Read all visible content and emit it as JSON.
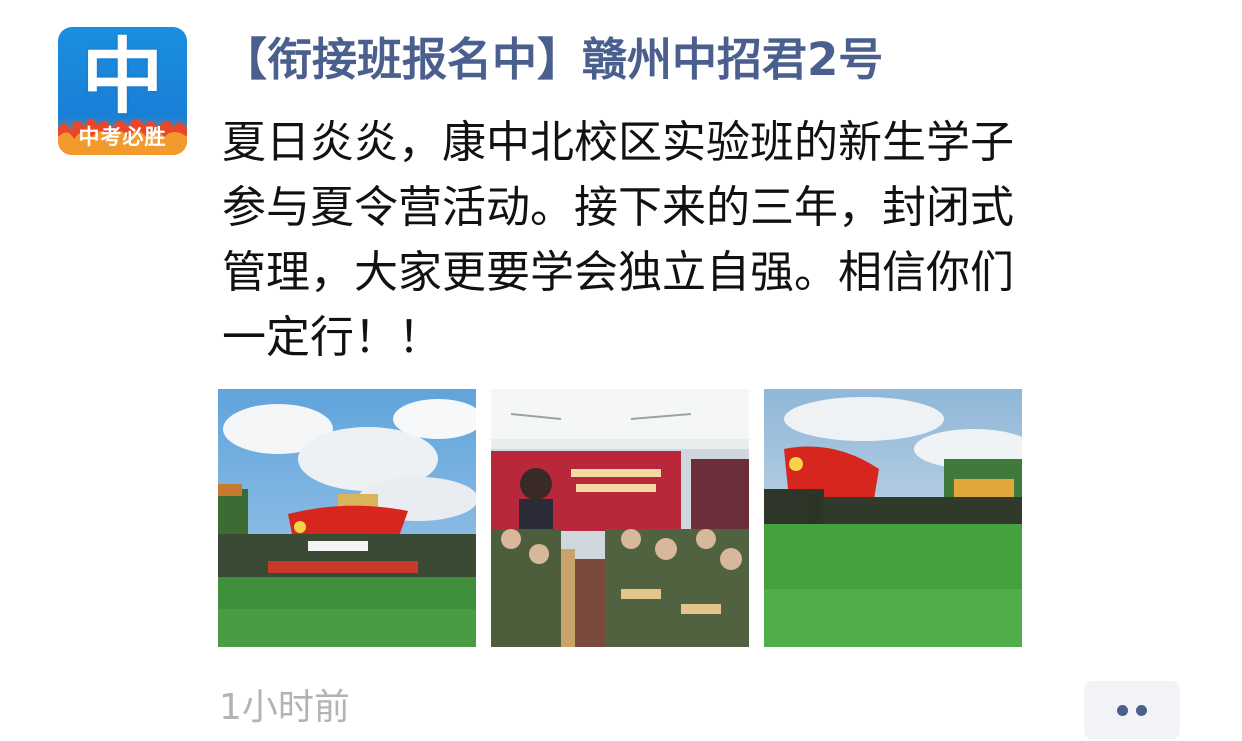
{
  "post": {
    "avatar": {
      "icon": "zhongkao-logo-icon",
      "big_char": "中",
      "slogan": "中考必胜",
      "colors": {
        "top": "#1a8fe0",
        "bottom": "#f0832a"
      }
    },
    "author": "【衔接班报名中】赣州中招君2号",
    "content": "夏日炎炎，康中北校区实验班的新生学子\n参与夏令营活动。接下来的三年，封闭式\n管理，大家更要学会独立自强。相信你们\n一定行！！",
    "photos": [
      {
        "description_icon": "outdoor-camp-group-photo-icon"
      },
      {
        "description_icon": "classroom-students-photo-icon"
      },
      {
        "description_icon": "field-formation-photo-icon"
      }
    ],
    "timestamp": "1小时前",
    "more_icon": "more-dots-icon"
  },
  "colors": {
    "author_name": "#4a5f8e",
    "timestamp": "#b3b3b3",
    "button_bg": "#f2f3f7"
  }
}
